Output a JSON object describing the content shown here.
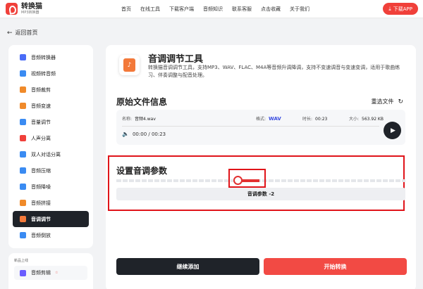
{
  "header": {
    "logo_name": "转换猫",
    "logo_sub": "MP3转换器",
    "nav": [
      "首页",
      "在线工具",
      "下载客户端",
      "音频知识",
      "联系客服",
      "点击收藏",
      "关于我们"
    ],
    "download_label": "下载APP"
  },
  "back_label": "返回首页",
  "sidebar": {
    "items": [
      {
        "label": "音频转换器",
        "color": "#4a6cf7"
      },
      {
        "label": "视频转音频",
        "color": "#3a8bf2"
      },
      {
        "label": "音频裁剪",
        "color": "#f08a2a"
      },
      {
        "label": "音频变速",
        "color": "#f08a2a"
      },
      {
        "label": "音量调节",
        "color": "#3a8bf2"
      },
      {
        "label": "人声分离",
        "color": "#f0403a"
      },
      {
        "label": "双人对话分离",
        "color": "#3a8bf2"
      },
      {
        "label": "音频压缩",
        "color": "#3a8bf2"
      },
      {
        "label": "音频降噪",
        "color": "#3a8bf2"
      },
      {
        "label": "音频拼接",
        "color": "#f08a2a"
      },
      {
        "label": "音调调节",
        "color": "#f3793a"
      },
      {
        "label": "音频倒放",
        "color": "#3a8bf2"
      }
    ],
    "active_index": 10,
    "section2_title": "新品上线",
    "section2_item": "音频剪辑",
    "section2_mark": "☆"
  },
  "tool": {
    "title": "音调调节工具",
    "desc": "转换猫音调调节工具，支持MP3、WAV、FLAC、M4A等音频升调降调，支持不变速调音与变速变调，适用于歌曲练习、伴奏调整与配音处理。"
  },
  "original": {
    "title": "原始文件信息",
    "reselect": "重选文件",
    "name_label": "名称:",
    "name_value": "音频4.wav",
    "format_label": "格式:",
    "format_value": "WAV",
    "duration_label": "时长:",
    "duration_value": "00:23",
    "size_label": "大小:",
    "size_value": "563.92 KB",
    "time": "00:00 / 00:23"
  },
  "params": {
    "title": "设置音调参数",
    "label": "音调参数 -2",
    "value": -2
  },
  "actions": {
    "continue": "继续添加",
    "start": "开始转换"
  }
}
